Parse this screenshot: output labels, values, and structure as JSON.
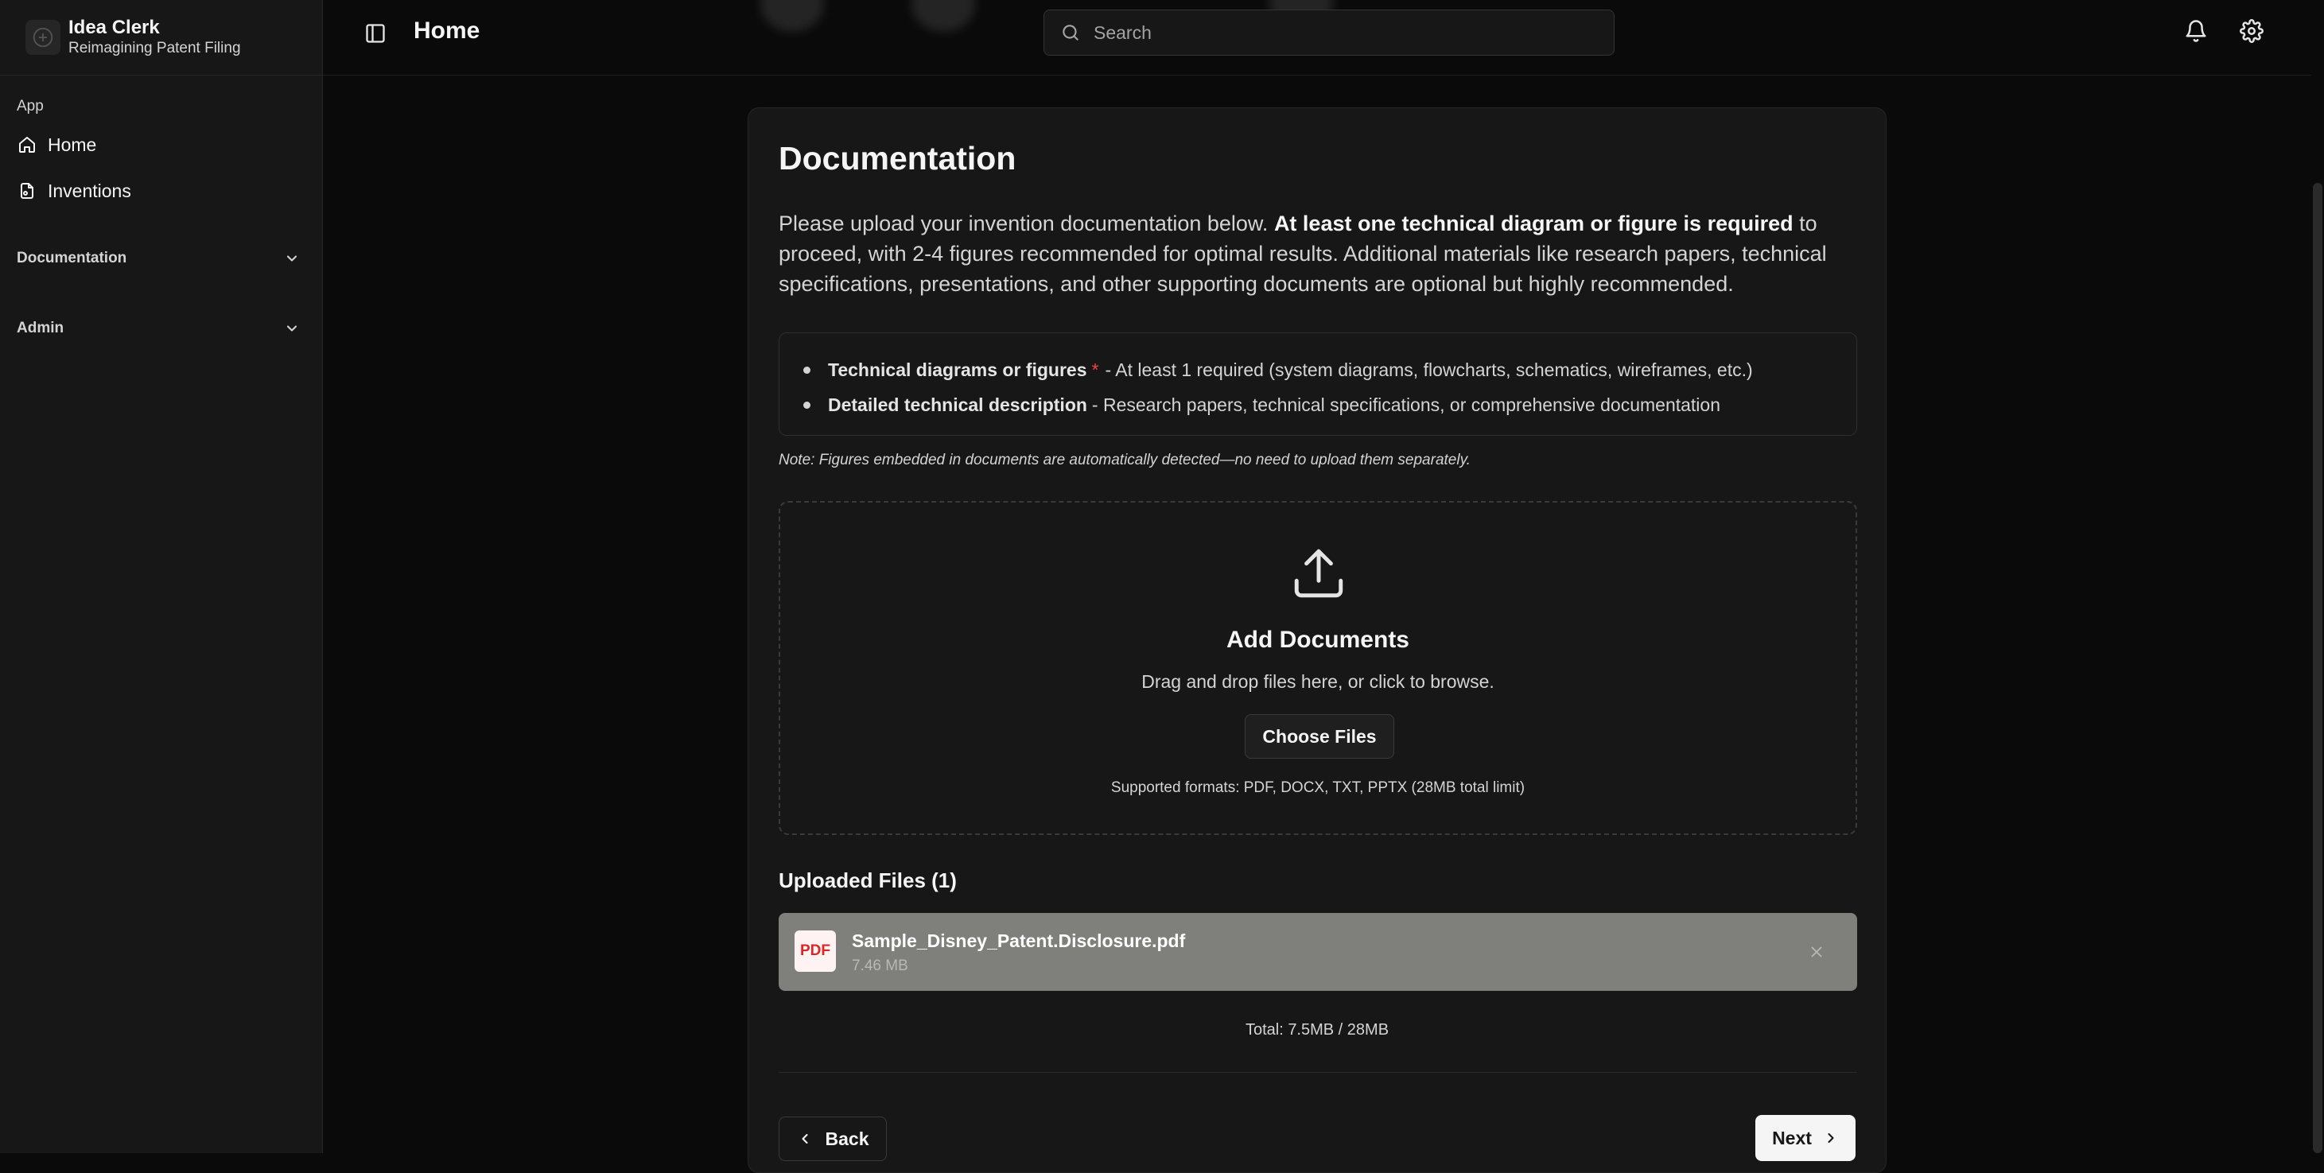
{
  "brand": {
    "name": "Idea Clerk",
    "tagline": "Reimagining Patent Filing",
    "logo_icon": "brand-logo-icon"
  },
  "sidebar": {
    "group_label": "App",
    "items": [
      {
        "label": "Home",
        "icon": "home-icon"
      },
      {
        "label": "Inventions",
        "icon": "file-icon"
      }
    ],
    "sections": [
      {
        "label": "Documentation",
        "icon": "chevron-down-icon"
      },
      {
        "label": "Admin",
        "icon": "chevron-down-icon"
      }
    ]
  },
  "header": {
    "title": "Home",
    "search_placeholder": "Search",
    "icons": [
      "sidebar-toggle-icon",
      "search-icon",
      "bell-icon",
      "gear-icon"
    ]
  },
  "card": {
    "title": "Documentation",
    "intro_before": "Please upload your invention documentation below. ",
    "intro_bold": "At least one technical diagram or figure is required",
    "intro_after": " to proceed, with 2-4 figures recommended for optimal results. Additional materials like research papers, technical specifications, presentations, and other supporting documents are optional but highly recommended.",
    "requirements": [
      {
        "title": "Technical diagrams or figures",
        "required_mark": "*",
        "text": "- At least 1 required (system diagrams, flowcharts, schematics, wireframes, etc.)"
      },
      {
        "title": "Detailed technical description",
        "required_mark": "",
        "text": "- Research papers, technical specifications, or comprehensive documentation"
      }
    ],
    "note": "Note: Figures embedded in documents are automatically detected—no need to upload them separately.",
    "dropzone": {
      "icon": "upload-icon",
      "title": "Add Documents",
      "subtitle": "Drag and drop files here, or click to browse.",
      "button": "Choose Files",
      "formats": "Supported formats: PDF, DOCX, TXT, PPTX (28MB total limit)"
    },
    "uploaded_title": "Uploaded Files (1)",
    "files": [
      {
        "badge": "PDF",
        "name": "Sample_Disney_Patent.Disclosure.pdf",
        "size": "7.46 MB"
      }
    ],
    "total": "Total: 7.5MB / 28MB",
    "back_label": "Back",
    "next_label": "Next"
  },
  "colors": {
    "background": "#0a0a0a",
    "card": "#171717",
    "file_row": "#7f7f7b",
    "required": "#ef4444",
    "pdf_badge": "#dc2626"
  }
}
